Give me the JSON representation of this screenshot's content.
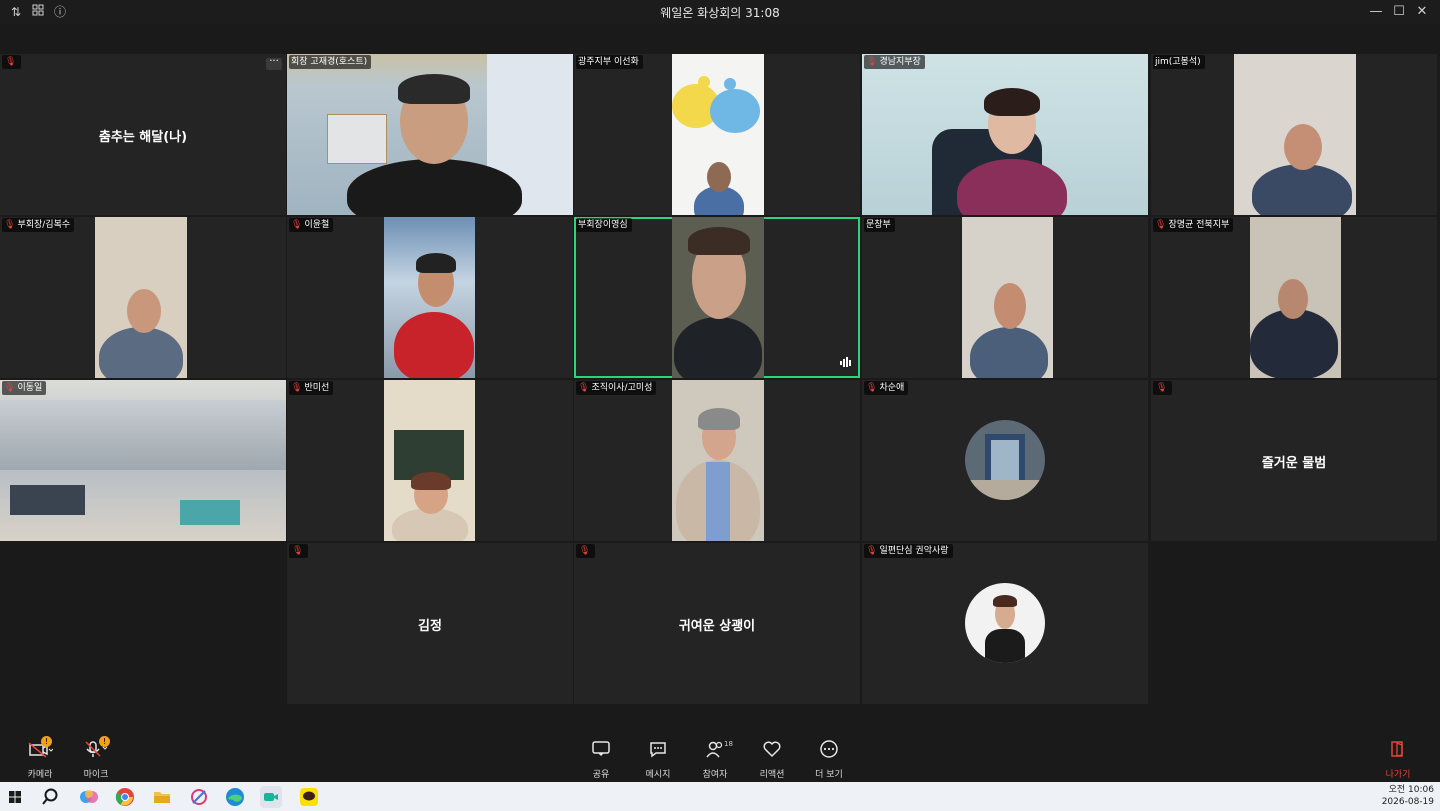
{
  "window": {
    "title": "웨일온 화상회의 31:08",
    "icons": [
      "sort-icon",
      "grid-icon",
      "info-icon"
    ],
    "controls": [
      "minimize-icon",
      "maximize-icon",
      "close-icon"
    ]
  },
  "participants": [
    {
      "name": "",
      "display": "춤추는 해달(나)",
      "type": "name"
    },
    {
      "name": "회장 고재경(호스트)",
      "type": "video"
    },
    {
      "name": "광주지부 이선화",
      "type": "video"
    },
    {
      "name": "경남지부장",
      "type": "video"
    },
    {
      "name": "jim(고봉석)",
      "type": "video"
    },
    {
      "name": "부회장/김복수",
      "type": "video"
    },
    {
      "name": "이윤철",
      "type": "video"
    },
    {
      "name": "부회장이영심",
      "type": "video",
      "active": true
    },
    {
      "name": "문창부",
      "type": "video"
    },
    {
      "name": "장명균 전북지부",
      "type": "video"
    },
    {
      "name": "이동일",
      "type": "video"
    },
    {
      "name": "반미선",
      "type": "video"
    },
    {
      "name": "조직이사/고미성",
      "type": "video"
    },
    {
      "name": "차순애",
      "type": "avatar"
    },
    {
      "name": "",
      "display": "즐거운 물범",
      "type": "name"
    },
    {
      "name": "",
      "display": "김정",
      "type": "name"
    },
    {
      "name": "",
      "display": "귀여운 상괭이",
      "type": "name"
    },
    {
      "name": "일편단심 권악사랑",
      "type": "avatar"
    }
  ],
  "toolbar": {
    "camera": {
      "label": "카메라",
      "badge": "!"
    },
    "mic": {
      "label": "마이크",
      "badge": "!"
    },
    "share": {
      "label": "공유"
    },
    "message": {
      "label": "메시지"
    },
    "participants": {
      "label": "참여자",
      "count": "18"
    },
    "reaction": {
      "label": "리액션"
    },
    "more": {
      "label": "더 보기"
    },
    "leave": {
      "label": "나가기"
    }
  },
  "taskbar": {
    "apps": [
      "windows-icon",
      "search-icon",
      "copilot-icon",
      "chrome-icon",
      "file-explorer-icon",
      "snipping-tool-icon",
      "edge-icon",
      "whale-on-icon",
      "kakaotalk-icon"
    ],
    "time": "오전 10:06",
    "date": "2026-08-19"
  },
  "colors": {
    "active_border": "#2bd47a",
    "leave": "#e8433a",
    "badge": "#f2a01c",
    "mic_muted": "#e8433a"
  }
}
